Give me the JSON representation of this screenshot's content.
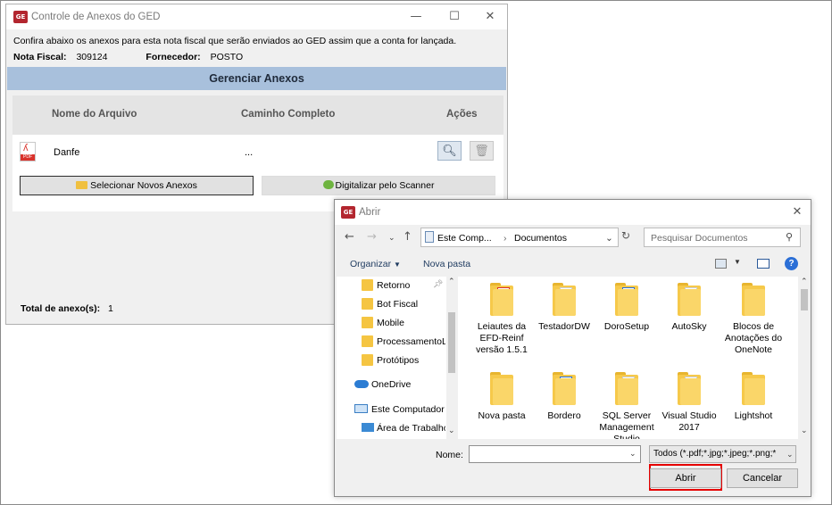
{
  "main_window": {
    "title": "Controle de Anexos do GED",
    "minimize": "—",
    "maximize": "☐",
    "close": "✕",
    "intro_text": "Confira abaixo os anexos para esta nota fiscal que serão enviados ao GED assim que a conta for lançada.",
    "nota_fiscal_label": "Nota Fiscal:",
    "nota_fiscal_value": "309124",
    "fornecedor_label": "Fornecedor:",
    "fornecedor_value": "POSTO",
    "section_header": "Gerenciar Anexos",
    "columns": [
      "Nome do Arquivo",
      "Caminho Completo",
      "Ações"
    ],
    "rows": [
      {
        "file_name": "Danfe",
        "path": "..."
      }
    ],
    "select_button": "Selecionar Novos Anexos",
    "scan_button": "Digitalizar pelo Scanner",
    "total_label": "Total de anexo(s):",
    "total_value": "1"
  },
  "open_dialog": {
    "title": "Abrir",
    "close": "✕",
    "breadcrumb": [
      "Este Comp...",
      "Documentos"
    ],
    "search_placeholder": "Pesquisar Documentos",
    "organize": "Organizar",
    "new_folder": "Nova pasta",
    "help": "?",
    "nav_items": [
      {
        "label": "Retorno",
        "pinned": true
      },
      {
        "label": "Bot Fiscal"
      },
      {
        "label": "Mobile"
      },
      {
        "label": "ProcessamentoL"
      },
      {
        "label": "Protótipos"
      },
      {
        "label": "OneDrive",
        "icon": "cloud-icon"
      },
      {
        "label": "Este Computador",
        "icon": "computer-icon"
      },
      {
        "label": "Área de Trabalho",
        "icon": "desktop-icon"
      }
    ],
    "files": [
      {
        "label": "Leiautes da EFD-Reinf versão 1.5.1",
        "variant": "red"
      },
      {
        "label": "TestadorDW",
        "variant": "doc"
      },
      {
        "label": "DoroSetup",
        "variant": "blue"
      },
      {
        "label": "AutoSky",
        "variant": "doc"
      },
      {
        "label": "Blocos de Anotações do OneNote",
        "variant": "plain"
      },
      {
        "label": "Nova pasta",
        "variant": "plain"
      },
      {
        "label": "Bordero",
        "variant": "blue"
      },
      {
        "label": "SQL Server Management Studio",
        "variant": "doc"
      },
      {
        "label": "Visual Studio 2017",
        "variant": "doc"
      },
      {
        "label": "Lightshot",
        "variant": "plain"
      }
    ],
    "name_label": "Nome:",
    "name_value": "",
    "filter_value": "Todos (*.pdf;*.jpg;*.jpeg;*.png;*",
    "open_button": "Abrir",
    "cancel_button": "Cancelar",
    "colors": {
      "highlight": "#e60000",
      "folder": "#f6c94a"
    }
  }
}
